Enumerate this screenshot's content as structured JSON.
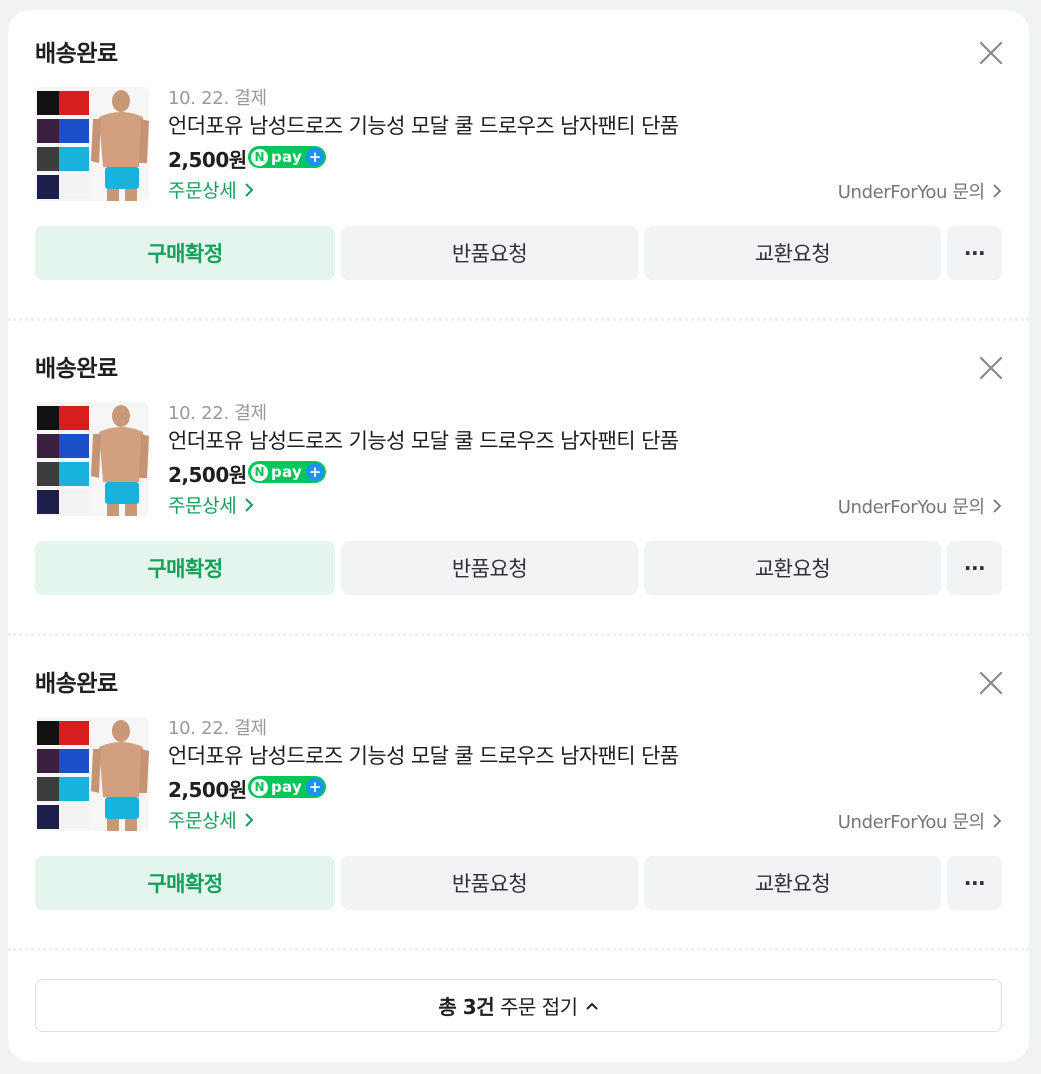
{
  "orders": [
    {
      "status": "배송완료",
      "date": "10. 22. 결제",
      "product_name": "언더포유 남성드로즈 기능성 모달 쿨 드로우즈 남자팬티 단품",
      "price": "2,500원",
      "npay_n": "N",
      "npay_text": "pay",
      "detail_link": "주문상세",
      "seller_inquiry": "UnderForYou 문의",
      "buttons": {
        "confirm": "구매확정",
        "return": "반품요청",
        "exchange": "교환요청",
        "more": "···"
      }
    },
    {
      "status": "배송완료",
      "date": "10. 22. 결제",
      "product_name": "언더포유 남성드로즈 기능성 모달 쿨 드로우즈 남자팬티 단품",
      "price": "2,500원",
      "npay_n": "N",
      "npay_text": "pay",
      "detail_link": "주문상세",
      "seller_inquiry": "UnderForYou 문의",
      "buttons": {
        "confirm": "구매확정",
        "return": "반품요청",
        "exchange": "교환요청",
        "more": "···"
      }
    },
    {
      "status": "배송완료",
      "date": "10. 22. 결제",
      "product_name": "언더포유 남성드로즈 기능성 모달 쿨 드로우즈 남자팬티 단품",
      "price": "2,500원",
      "npay_n": "N",
      "npay_text": "pay",
      "detail_link": "주문상세",
      "seller_inquiry": "UnderForYou 문의",
      "buttons": {
        "confirm": "구매확정",
        "return": "반품요청",
        "exchange": "교환요청",
        "more": "···"
      }
    }
  ],
  "collapse": {
    "count_label": "총 3건",
    "action_label": "주문 접기"
  },
  "colors": {
    "accent_green": "#13a05a",
    "confirm_bg": "#e3f5ec",
    "npay_green": "#03c75a"
  },
  "icons": {
    "close": "close-icon",
    "chevron_right": "chevron-right-icon",
    "chevron_up": "chevron-up-icon",
    "npay_plus": "plus-icon"
  }
}
